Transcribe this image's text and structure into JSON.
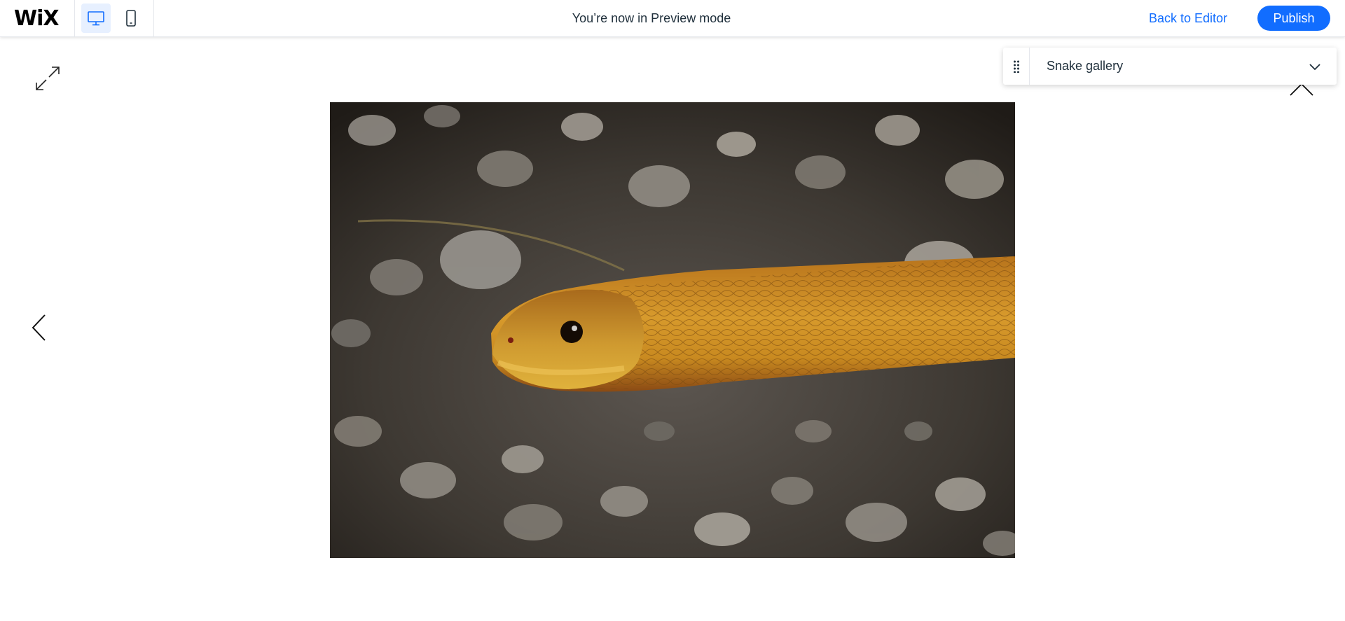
{
  "topbar": {
    "logo_text": "WiX",
    "preview_message": "You’re now in Preview mode",
    "back_to_editor_label": "Back to Editor",
    "publish_label": "Publish",
    "device_toggle": {
      "selected": "desktop",
      "options": [
        "desktop-icon",
        "mobile-icon"
      ]
    }
  },
  "gallery_panel": {
    "selected_label": "Snake gallery"
  },
  "lightbox": {
    "image_subject": "snake-photo",
    "icons": [
      "expand-icon",
      "previous-arrow-icon",
      "close-icon"
    ]
  },
  "colors": {
    "accent": "#116dff",
    "accent_light": "#e7f0ff",
    "text_dark": "#20303c",
    "divider": "#e5e7ec"
  }
}
